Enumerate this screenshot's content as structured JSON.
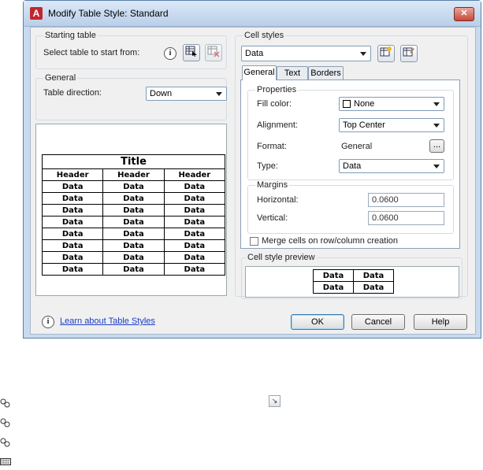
{
  "window": {
    "title": "Modify Table Style: Standard",
    "close_label": "✕",
    "app_icon_glyph": "A"
  },
  "starting_table": {
    "group_label": "Starting table",
    "prompt": "Select table to start from:",
    "info_glyph": "i"
  },
  "general": {
    "group_label": "General",
    "direction_label": "Table direction:",
    "direction_value": "Down"
  },
  "preview": {
    "title": "Title",
    "headers": [
      "Header",
      "Header",
      "Header"
    ],
    "rows": [
      [
        "Data",
        "Data",
        "Data"
      ],
      [
        "Data",
        "Data",
        "Data"
      ],
      [
        "Data",
        "Data",
        "Data"
      ],
      [
        "Data",
        "Data",
        "Data"
      ],
      [
        "Data",
        "Data",
        "Data"
      ],
      [
        "Data",
        "Data",
        "Data"
      ],
      [
        "Data",
        "Data",
        "Data"
      ],
      [
        "Data",
        "Data",
        "Data"
      ]
    ]
  },
  "cell_styles": {
    "group_label": "Cell styles",
    "selected": "Data"
  },
  "tabs": [
    {
      "label": "General",
      "active": true
    },
    {
      "label": "Text",
      "active": false
    },
    {
      "label": "Borders",
      "active": false
    }
  ],
  "properties": {
    "group_label": "Properties",
    "fill_color_label": "Fill color:",
    "fill_color_value": "None",
    "alignment_label": "Alignment:",
    "alignment_value": "Top Center",
    "format_label": "Format:",
    "format_value": "General",
    "format_button": "...",
    "type_label": "Type:",
    "type_value": "Data"
  },
  "margins": {
    "group_label": "Margins",
    "horizontal_label": "Horizontal:",
    "horizontal_value": "0.0600",
    "vertical_label": "Vertical:",
    "vertical_value": "0.0600"
  },
  "merge_checkbox_label": "Merge cells on row/column creation",
  "cell_style_preview": {
    "group_label": "Cell style preview",
    "cells": [
      [
        "Data",
        "Data"
      ],
      [
        "Data",
        "Data"
      ]
    ]
  },
  "footer": {
    "learn_link": "Learn about Table Styles",
    "ok": "OK",
    "cancel": "Cancel",
    "help": "Help"
  },
  "colors": {
    "accent": "#3c7fb1",
    "link": "#1a3ec8",
    "close": "#c7483a"
  }
}
